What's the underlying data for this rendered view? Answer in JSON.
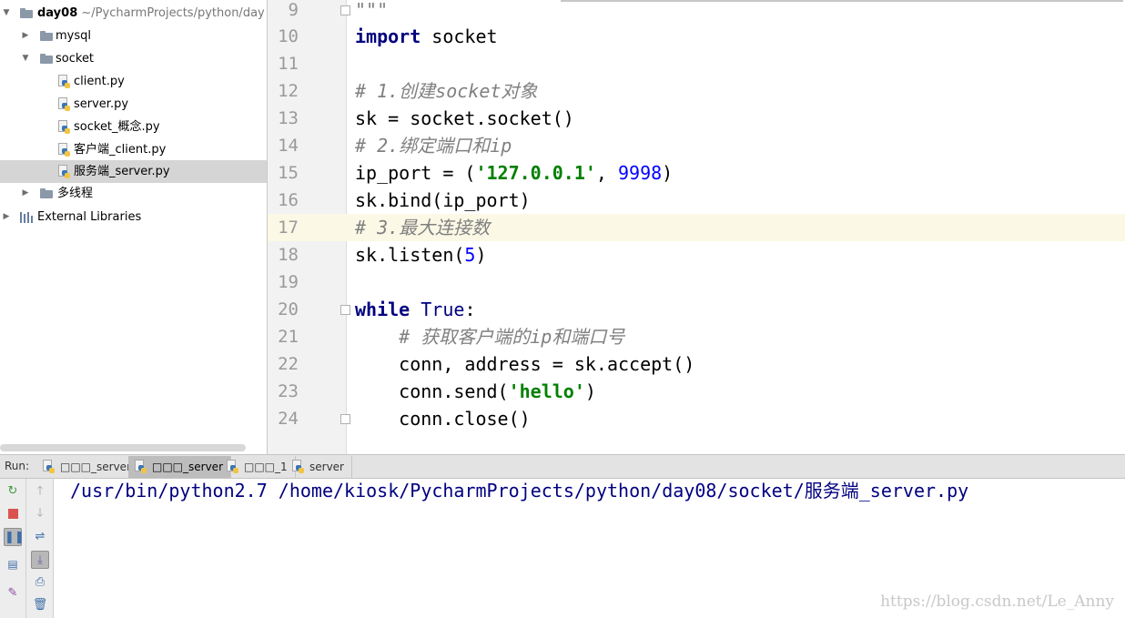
{
  "project_tree": {
    "root": {
      "name": "day08",
      "path": "~/PycharmProjects/python/day"
    },
    "items": [
      {
        "type": "folder",
        "label": "mysql",
        "expanded": false
      },
      {
        "type": "folder",
        "label": "socket",
        "expanded": true
      },
      {
        "type": "file",
        "label": "client.py"
      },
      {
        "type": "file",
        "label": "server.py"
      },
      {
        "type": "file",
        "label": "socket_概念.py"
      },
      {
        "type": "file",
        "label": "客户端_client.py"
      },
      {
        "type": "file",
        "label": "服务端_server.py",
        "selected": true
      },
      {
        "type": "folder",
        "label": "多线程",
        "expanded": false
      },
      {
        "type": "library",
        "label": "External Libraries"
      }
    ]
  },
  "editor": {
    "current_line": "17",
    "lines": [
      {
        "n": "9",
        "code": "\"\"\""
      },
      {
        "n": "10",
        "code": "import socket"
      },
      {
        "n": "11",
        "code": ""
      },
      {
        "n": "12",
        "code": "# 1.创建socket对象"
      },
      {
        "n": "13",
        "code": "sk = socket.socket()"
      },
      {
        "n": "14",
        "code": "# 2.绑定端口和ip"
      },
      {
        "n": "15",
        "code": "ip_port = ('127.0.0.1', 9998)"
      },
      {
        "n": "16",
        "code": "sk.bind(ip_port)"
      },
      {
        "n": "17",
        "code": "# 3.最大连接数"
      },
      {
        "n": "18",
        "code": "sk.listen(5)"
      },
      {
        "n": "19",
        "code": ""
      },
      {
        "n": "20",
        "code": "while True:"
      },
      {
        "n": "21",
        "code": "    # 获取客户端的ip和端口号"
      },
      {
        "n": "22",
        "code": "    conn, address = sk.accept()"
      },
      {
        "n": "23",
        "code": "    conn.send('hello')"
      },
      {
        "n": "24",
        "code": "    conn.close()"
      }
    ]
  },
  "run_panel": {
    "label": "Run:",
    "tabs": [
      {
        "label": "□□□_server",
        "active": false
      },
      {
        "label": "□□□_server",
        "active": true
      },
      {
        "label": "□□□_1",
        "active": false
      },
      {
        "label": "server",
        "active": false
      }
    ],
    "console": "/usr/bin/python2.7 /home/kiosk/PycharmProjects/python/day08/socket/服务端_server.py",
    "toolbar_icons": [
      "rerun-icon",
      "stop-icon",
      "pause-icon",
      "layout-icon",
      "pin-icon",
      "up-arrow-icon",
      "down-arrow-icon",
      "soft-wrap-icon",
      "scroll-to-end-icon",
      "print-icon",
      "trash-icon"
    ]
  },
  "watermark": "https://blog.csdn.net/Le_Anny",
  "colors": {
    "keyword": "#000080",
    "string": "#008000",
    "number": "#0000ff",
    "comment": "#808080",
    "console_text": "#000080",
    "current_line": "#fbf8e5"
  }
}
